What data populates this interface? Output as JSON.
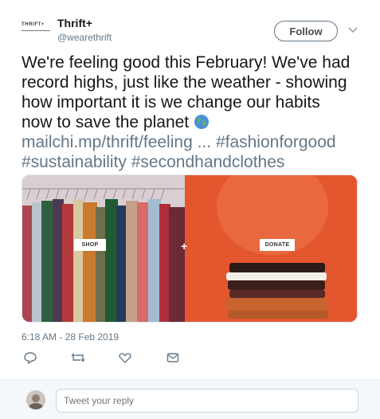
{
  "tweet": {
    "logo_text": "THRIFT+",
    "display_name": "Thrift+",
    "handle": "@wearethrift",
    "follow_label": "Follow",
    "text_line1": "We're feeling good this February! We've had",
    "text_line2": "record highs, just like the weather - showing",
    "text_line3": "how important it is we change our habits",
    "text_line4": "now to save the planet",
    "link_text": "mailchi.mp/thrift/feeling ...",
    "hashtag1": "#fashionforgood",
    "hashtag2": "#sustainability",
    "hashtag3": "#secondhandclothes",
    "timestamp": "6:18 AM - 28 Feb 2019"
  },
  "media": {
    "shop_label": "SHOP",
    "plus_label": "+",
    "donate_label": "DONATE"
  },
  "actions": {
    "reply_icon": "reply-icon",
    "retweet_icon": "retweet-icon",
    "like_icon": "heart-icon",
    "dm_icon": "mail-icon"
  },
  "reply_bar": {
    "placeholder": "Tweet your reply"
  },
  "colors": {
    "accent_orange": "#e4572e",
    "muted_text": "#657786",
    "text": "#14171a"
  }
}
